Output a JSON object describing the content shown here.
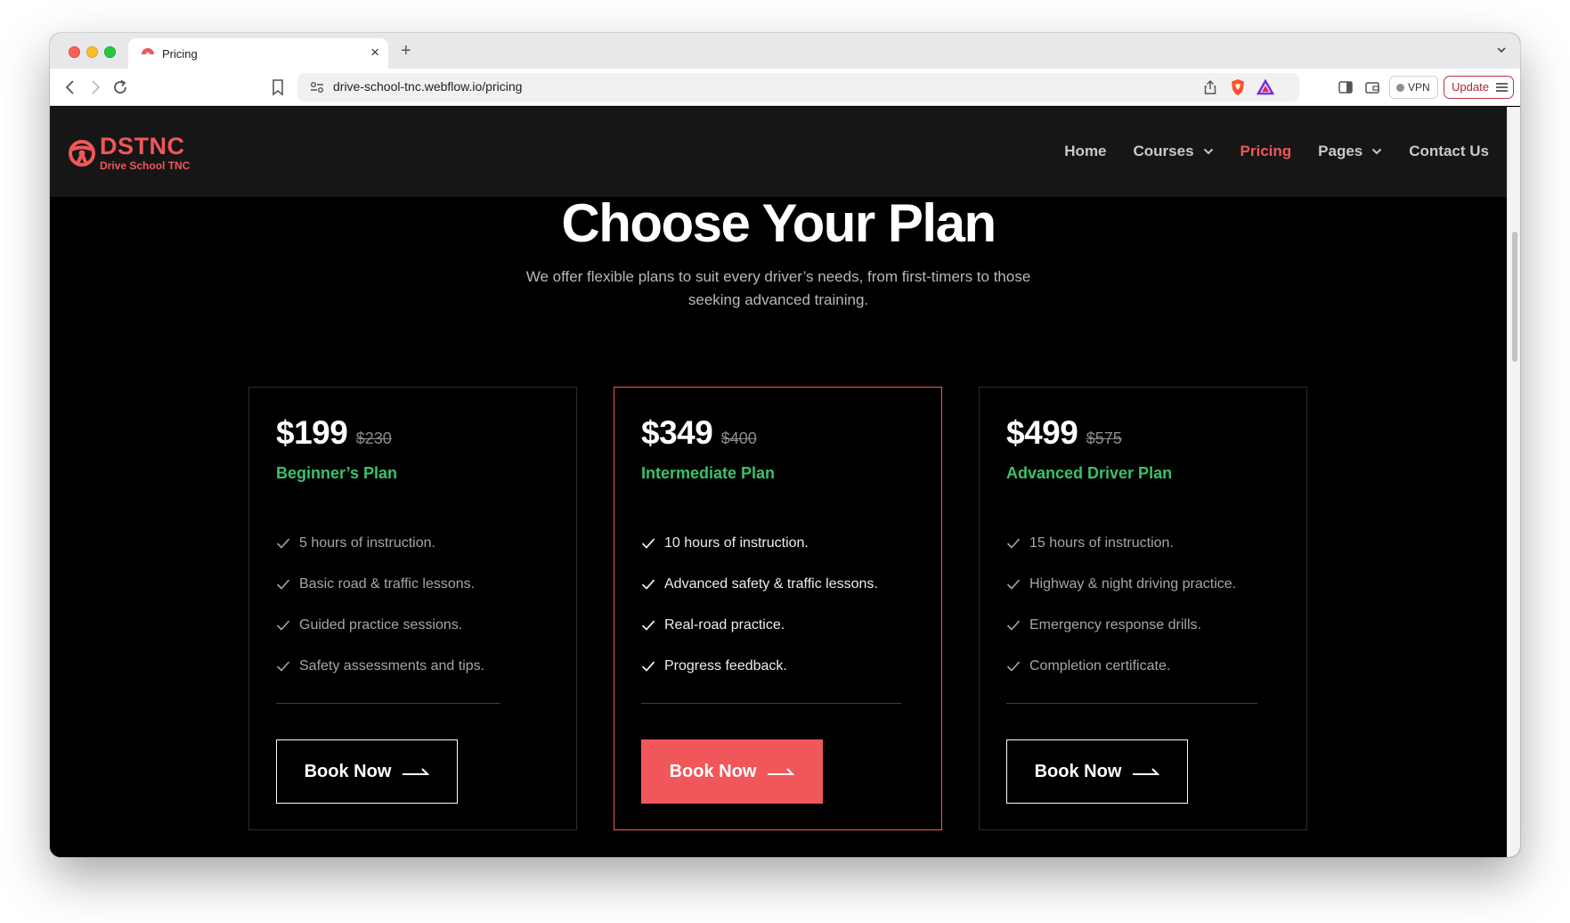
{
  "browser": {
    "tab_title": "Pricing",
    "url": "drive-school-tnc.webflow.io/pricing",
    "vpn_label": "VPN",
    "update_label": "Update"
  },
  "site": {
    "logo_text": "DSTNC",
    "logo_subtext": "Drive School TNC",
    "brand_color": "#f0575a",
    "nav": [
      {
        "label": "Home",
        "dropdown": false,
        "active": false
      },
      {
        "label": "Courses",
        "dropdown": true,
        "active": false
      },
      {
        "label": "Pricing",
        "dropdown": false,
        "active": true
      },
      {
        "label": "Pages",
        "dropdown": true,
        "active": false
      },
      {
        "label": "Contact Us",
        "dropdown": false,
        "active": false
      }
    ]
  },
  "hero": {
    "title": "Choose Your Plan",
    "subtitle": "We offer flexible plans to suit every driver’s needs, from first-timers to those seeking advanced training."
  },
  "plans": [
    {
      "price": "$199",
      "old_price": "$230",
      "name": "Beginner’s Plan",
      "features": [
        "5 hours of instruction.",
        "Basic road & traffic lessons.",
        "Guided practice sessions.",
        "Safety assessments and tips."
      ],
      "button_label": "Book Now"
    },
    {
      "price": "$349",
      "old_price": "$400",
      "name": "Intermediate Plan",
      "features": [
        "10 hours of instruction.",
        "Advanced safety & traffic lessons.",
        "Real-road practice.",
        "Progress feedback."
      ],
      "button_label": "Book Now"
    },
    {
      "price": "$499",
      "old_price": "$575",
      "name": "Advanced Driver Plan",
      "features": [
        "15 hours of instruction.",
        "Highway & night driving practice.",
        "Emergency response drills.",
        "Completion certificate."
      ],
      "button_label": "Book Now"
    }
  ],
  "colors": {
    "accent": "#f0575a",
    "plan_name": "#39c26a",
    "background": "#000000"
  }
}
